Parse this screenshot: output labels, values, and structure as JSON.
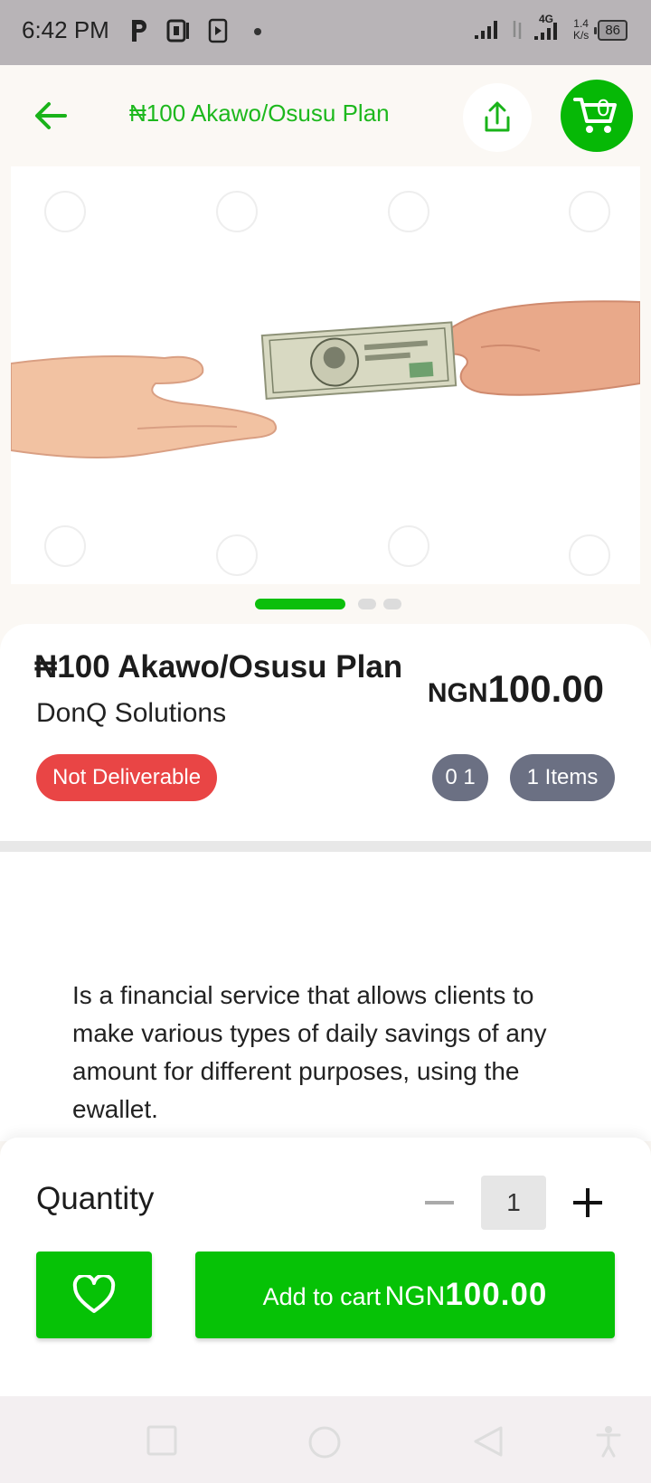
{
  "status_bar": {
    "time": "6:42 PM",
    "network_label": "4G",
    "speed_value": "1.4",
    "speed_unit": "K/s",
    "battery": "86"
  },
  "header": {
    "title": "₦100 Akawo/Osusu Plan",
    "cart_count": "0",
    "icons": [
      "back-arrow-icon",
      "share-icon",
      "cart-icon"
    ]
  },
  "carousel": {
    "image": "hands-exchanging-dollar-bill",
    "slide_count": 3,
    "active_index": 0
  },
  "product": {
    "name": "₦100 Akawo/Osusu Plan",
    "vendor": "DonQ Solutions",
    "price_currency": "NGN",
    "price_amount": "100.00",
    "delivery_badge": "Not Deliverable",
    "count_badge": "0 1",
    "items_badge": "1 Items"
  },
  "description": "Is a financial service that allows clients to make various types of daily savings of any amount for different purposes, using the ewallet.",
  "purchase": {
    "quantity_label": "Quantity",
    "quantity_value": "1",
    "add_to_cart_label": "Add to cart",
    "add_to_cart_currency": "NGN",
    "add_to_cart_amount": "100.00"
  },
  "colors": {
    "brand_green": "#06b806",
    "badge_red": "#e94545",
    "badge_gray": "#6b7083"
  }
}
